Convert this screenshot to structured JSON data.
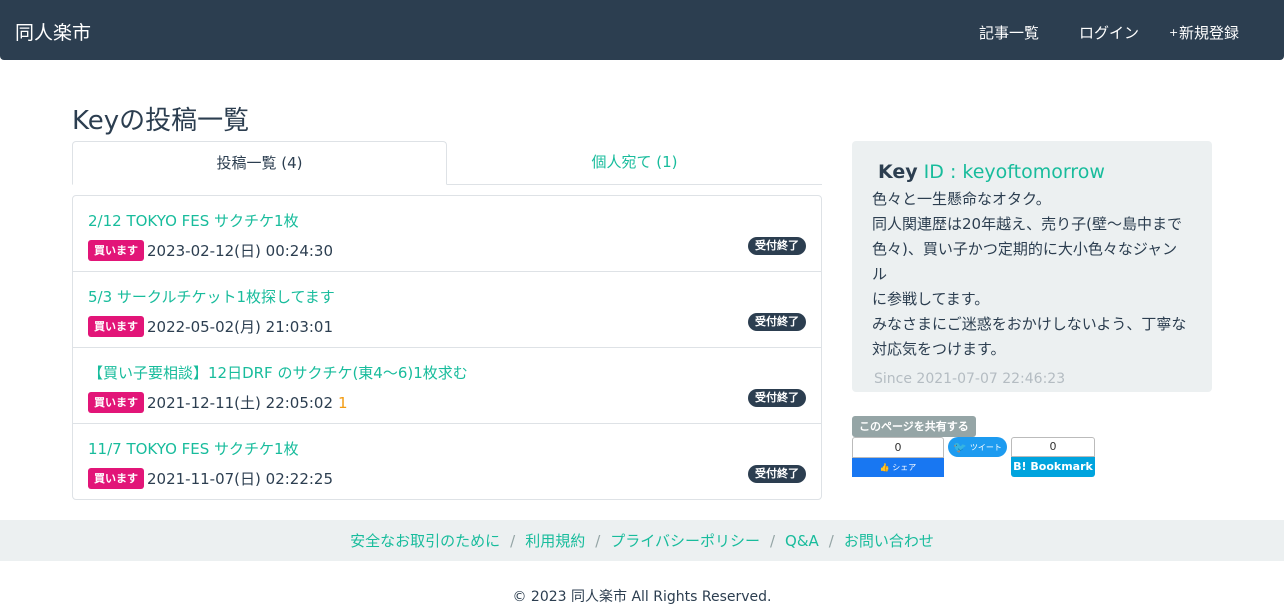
{
  "header": {
    "brand": "同人楽市",
    "nav": [
      {
        "icon": "",
        "label": "記事一覧"
      },
      {
        "icon": "",
        "label": "ログイン"
      },
      {
        "icon": "+",
        "label": "新規登録"
      }
    ]
  },
  "page_title": "Keyの投稿一覧",
  "tabs": [
    {
      "label": "投稿一覧 (4)",
      "active": true
    },
    {
      "label": "個人宛て (1)",
      "active": false
    }
  ],
  "posts": [
    {
      "title": "2/12 TOKYO FES サクチケ1枚",
      "type": "買います",
      "date": "2023-02-12(日) 00:24:30",
      "comments": "",
      "status": "受付終了"
    },
    {
      "title": "5/3 サークルチケット1枚探してます",
      "type": "買います",
      "date": "2022-05-02(月) 21:03:01",
      "comments": "",
      "status": "受付終了"
    },
    {
      "title": "【買い子要相談】12日DRF のサクチケ(東4〜6)1枚求む",
      "type": "買います",
      "date": "2021-12-11(土) 22:05:02",
      "comments": " 1",
      "status": "受付終了"
    },
    {
      "title": "11/7 TOKYO FES サクチケ1枚",
      "type": "買います",
      "date": "2021-11-07(日) 02:22:25",
      "comments": "",
      "status": "受付終了"
    }
  ],
  "profile": {
    "icon": "",
    "name": "Key",
    "id": "ID : keyoftomorrow",
    "bio": [
      "色々と一生懸命なオタク。",
      "同人関連歴は20年越え、売り子(壁〜島中まで",
      "色々)、買い子かつ定期的に大小色々なジャンル",
      "に参戦してます。",
      "みなさまにご迷惑をおかけしないよう、丁寧な",
      "対応気をつけます。"
    ],
    "since_icon": "",
    "since": "Since 2021-07-07 22:46:23"
  },
  "share": {
    "label": "このページを共有する",
    "fb_count": "0",
    "fb_label": "シェア",
    "tw_label": "ツイート",
    "hb_count": "0",
    "hb_label": "B! Bookmark"
  },
  "footer": {
    "links": [
      "安全なお取引のために",
      "利用規約",
      "プライバシーポリシー",
      "Q&A",
      "お問い合わせ"
    ],
    "separator": "/",
    "copyright": "© 2023 同人楽市 All Rights Reserved."
  },
  "colors": {
    "navbar": "#2c3e50",
    "accent": "#18bc9c",
    "buy_badge": "#e21578",
    "closed_badge": "#2c3e50",
    "panel": "#ecf0f1",
    "comment": "#f39c12"
  }
}
